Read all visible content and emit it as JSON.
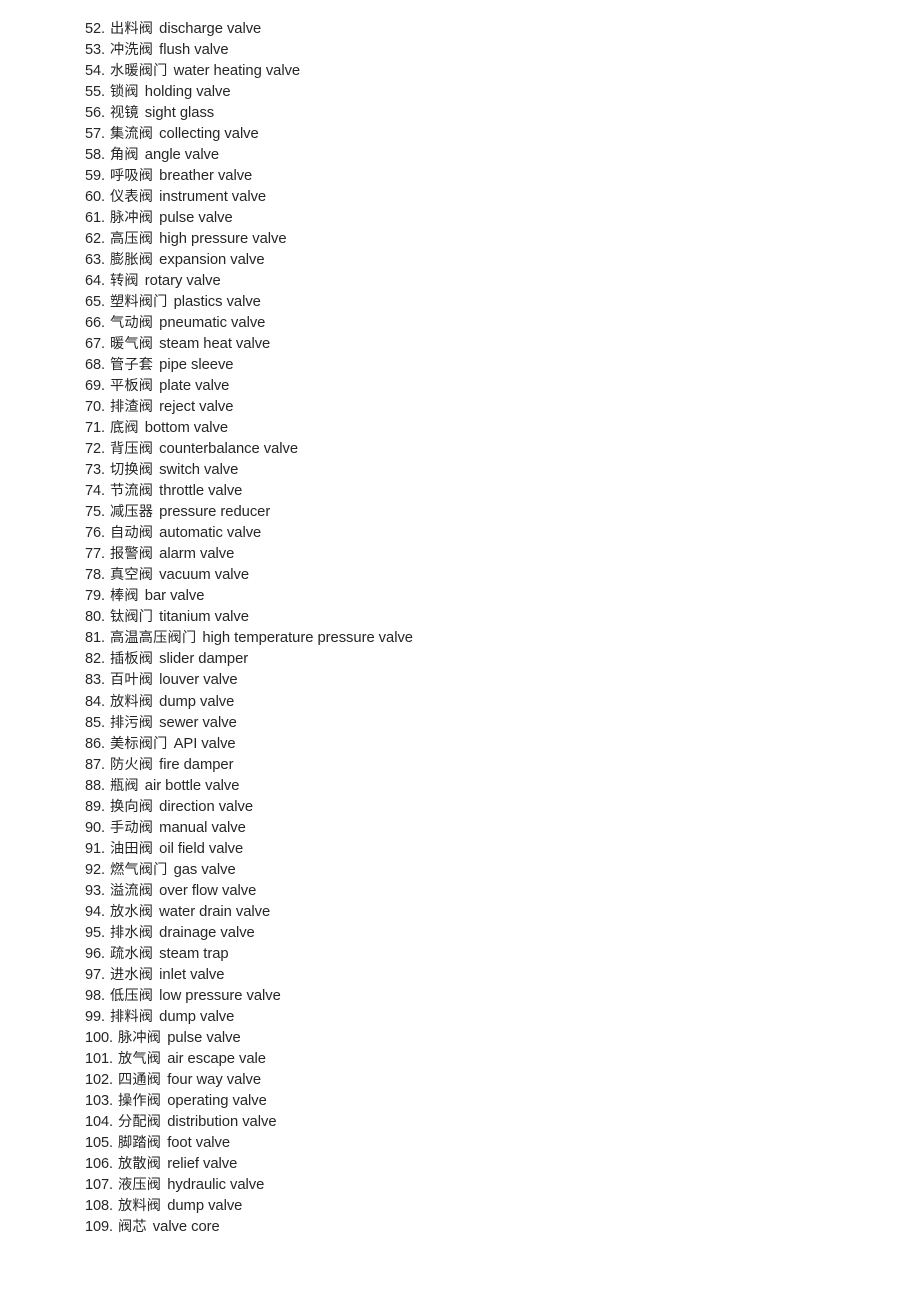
{
  "document": {
    "type": "glossary-list",
    "text_color": "#262626",
    "background_color": "#ffffff",
    "entries": [
      {
        "number": "52.",
        "cn": "出料阀",
        "en": "discharge valve"
      },
      {
        "number": "53.",
        "cn": "冲洗阀",
        "en": "flush valve"
      },
      {
        "number": "54.",
        "cn": "水暖阀门",
        "en": "water heating valve"
      },
      {
        "number": "55.",
        "cn": "锁阀",
        "en": "holding valve"
      },
      {
        "number": "56.",
        "cn": "视镜",
        "en": "sight glass"
      },
      {
        "number": "57.",
        "cn": "集流阀",
        "en": "collecting valve"
      },
      {
        "number": "58.",
        "cn": "角阀",
        "en": "angle valve"
      },
      {
        "number": "59.",
        "cn": "呼吸阀",
        "en": "breather valve"
      },
      {
        "number": "60.",
        "cn": "仪表阀",
        "en": "instrument valve"
      },
      {
        "number": "61.",
        "cn": "脉冲阀",
        "en": "pulse valve"
      },
      {
        "number": "62.",
        "cn": "高压阀",
        "en": "high pressure valve"
      },
      {
        "number": "63.",
        "cn": "膨胀阀",
        "en": "expansion valve"
      },
      {
        "number": "64.",
        "cn": "转阀",
        "en": "rotary valve"
      },
      {
        "number": "65.",
        "cn": "塑料阀门",
        "en": "plastics valve"
      },
      {
        "number": "66.",
        "cn": "气动阀",
        "en": "pneumatic valve"
      },
      {
        "number": "67.",
        "cn": "暖气阀",
        "en": "steam heat valve"
      },
      {
        "number": "68.",
        "cn": "管子套",
        "en": "pipe sleeve"
      },
      {
        "number": "69.",
        "cn": "平板阀",
        "en": "plate valve"
      },
      {
        "number": "70.",
        "cn": "排渣阀",
        "en": "reject valve"
      },
      {
        "number": "71.",
        "cn": "底阀",
        "en": "bottom valve"
      },
      {
        "number": "72.",
        "cn": "背压阀",
        "en": "counterbalance valve"
      },
      {
        "number": "73.",
        "cn": "切换阀",
        "en": "switch valve"
      },
      {
        "number": "74.",
        "cn": "节流阀",
        "en": "throttle valve"
      },
      {
        "number": "75.",
        "cn": "减压器",
        "en": "pressure reducer"
      },
      {
        "number": "76.",
        "cn": "自动阀",
        "en": "automatic valve"
      },
      {
        "number": "77.",
        "cn": "报警阀",
        "en": "alarm valve"
      },
      {
        "number": "78.",
        "cn": "真空阀",
        "en": "vacuum valve"
      },
      {
        "number": "79.",
        "cn": "棒阀",
        "en": "bar valve"
      },
      {
        "number": "80.",
        "cn": "钛阀门",
        "en": "titanium valve"
      },
      {
        "number": "81.",
        "cn": "高温高压阀门",
        "en": "high temperature pressure valve"
      },
      {
        "number": "82.",
        "cn": "插板阀",
        "en": "slider damper"
      },
      {
        "number": "83.",
        "cn": "百叶阀",
        "en": "louver valve"
      },
      {
        "number": "84.",
        "cn": "放料阀",
        "en": "dump valve"
      },
      {
        "number": "85.",
        "cn": "排污阀",
        "en": "sewer valve"
      },
      {
        "number": "86.",
        "cn": "美标阀门",
        "en": "API valve"
      },
      {
        "number": "87.",
        "cn": "防火阀",
        "en": "fire damper"
      },
      {
        "number": "88.",
        "cn": "瓶阀",
        "en": "air bottle valve"
      },
      {
        "number": "89.",
        "cn": "换向阀",
        "en": "direction valve"
      },
      {
        "number": "90.",
        "cn": "手动阀",
        "en": "manual valve"
      },
      {
        "number": "91.",
        "cn": "油田阀",
        "en": "oil field valve"
      },
      {
        "number": "92.",
        "cn": "燃气阀门",
        "en": "gas valve"
      },
      {
        "number": "93.",
        "cn": "溢流阀",
        "en": "over flow valve"
      },
      {
        "number": "94.",
        "cn": "放水阀",
        "en": "water drain valve"
      },
      {
        "number": "95.",
        "cn": "排水阀",
        "en": "drainage valve"
      },
      {
        "number": "96.",
        "cn": "疏水阀",
        "en": "steam trap"
      },
      {
        "number": "97.",
        "cn": "进水阀",
        "en": "inlet valve"
      },
      {
        "number": "98.",
        "cn": "低压阀",
        "en": "low pressure valve"
      },
      {
        "number": "99.",
        "cn": "排料阀",
        "en": "dump valve"
      },
      {
        "number": "100.",
        "cn": "脉冲阀",
        "en": "pulse valve"
      },
      {
        "number": "101.",
        "cn": "放气阀",
        "en": "air escape vale"
      },
      {
        "number": "102.",
        "cn": "四通阀",
        "en": "four way valve"
      },
      {
        "number": "103.",
        "cn": "操作阀",
        "en": "operating valve"
      },
      {
        "number": "104.",
        "cn": "分配阀",
        "en": "distribution valve"
      },
      {
        "number": "105.",
        "cn": "脚踏阀",
        "en": "foot valve"
      },
      {
        "number": "106.",
        "cn": "放散阀",
        "en": "relief valve"
      },
      {
        "number": "107.",
        "cn": "液压阀",
        "en": "hydraulic valve"
      },
      {
        "number": "108.",
        "cn": "放料阀",
        "en": "dump valve"
      },
      {
        "number": "109.",
        "cn": "阀芯",
        "en": "valve core"
      }
    ]
  }
}
